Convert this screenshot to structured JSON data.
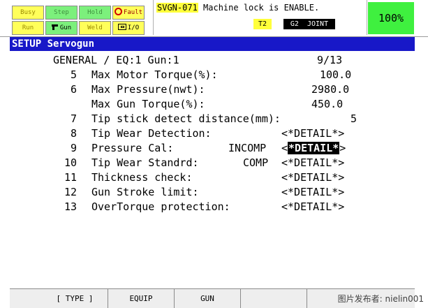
{
  "status": {
    "leds": {
      "busy": "Busy",
      "step": "Step",
      "hold": "Hold",
      "fault": "Fault",
      "run": "Run",
      "gun": "Gun",
      "weld": "Weld",
      "io": "I/O"
    },
    "message": {
      "code": "SVGN-071",
      "text": " Machine lock is ENABLE."
    },
    "mode": "T2",
    "coord": "G2  JOINT",
    "override": "100%"
  },
  "title": "SETUP Servogun",
  "screen": {
    "header": {
      "left": "GENERAL / EQ:1 Gun:1",
      "page": "9/13"
    },
    "rows": [
      {
        "num": "5",
        "label": "Max Motor Torque(%):",
        "value": "100.0"
      },
      {
        "num": "6",
        "label": "Max Pressure(nwt):",
        "value": "2980.0"
      },
      {
        "num": "",
        "label": "Max Gun Torque(%):",
        "value": "450.0"
      },
      {
        "num": "7",
        "label": "Tip stick detect distance(mm):",
        "value": "5"
      },
      {
        "num": "8",
        "label": "Tip Wear Detection:",
        "status": "",
        "value": "<*DETAIL*>"
      },
      {
        "num": "9",
        "label": "Pressure Cal:",
        "status": "INCOMP",
        "value_prefix": "<",
        "value_sel": "*DETAIL*",
        "value_suffix": ">"
      },
      {
        "num": "10",
        "label": "Tip Wear Standrd:",
        "status": "COMP",
        "value": "<*DETAIL*>"
      },
      {
        "num": "11",
        "label": "Thickness check:",
        "status": "",
        "value": "<*DETAIL*>"
      },
      {
        "num": "12",
        "label": "Gun Stroke limit:",
        "status": "",
        "value": "<*DETAIL*>"
      },
      {
        "num": "13",
        "label": "OverTorque protection:",
        "status": "",
        "value": "<*DETAIL*>"
      }
    ]
  },
  "fkeys": [
    "[ TYPE ]",
    "EQUIP",
    "GUN",
    "",
    ""
  ],
  "watermark": "图片发布者: nielin001",
  "colors": {
    "title_bg": "#1818c8",
    "override_bg": "#3ff03f",
    "led_yellow": "#ffff5a",
    "led_green": "#7cf07c"
  }
}
